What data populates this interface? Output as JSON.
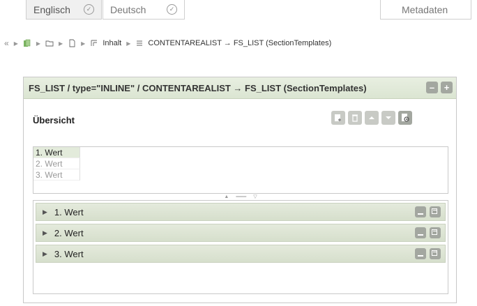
{
  "languages": {
    "active": "Englisch",
    "inactive": "Deutsch",
    "metadata": "Metadaten"
  },
  "breadcrumb": {
    "content": "Inhalt",
    "path": "CONTENTAREALIST → FS_LIST (SectionTemplates)"
  },
  "panel": {
    "title": "FS_LIST / type=\"INLINE\" / CONTENTAREALIST → FS_LIST (SectionTemplates)",
    "overview_title": "Übersicht"
  },
  "value_list": [
    "1. Wert",
    "2. Wert",
    "3. Wert"
  ],
  "entries": [
    {
      "label": "1. Wert"
    },
    {
      "label": "2. Wert"
    },
    {
      "label": "3. Wert"
    }
  ],
  "colors": {
    "header_bg": "#dbe5d2",
    "button_gray": "#a3a7a0",
    "selected_bg": "#e3ebdb"
  }
}
